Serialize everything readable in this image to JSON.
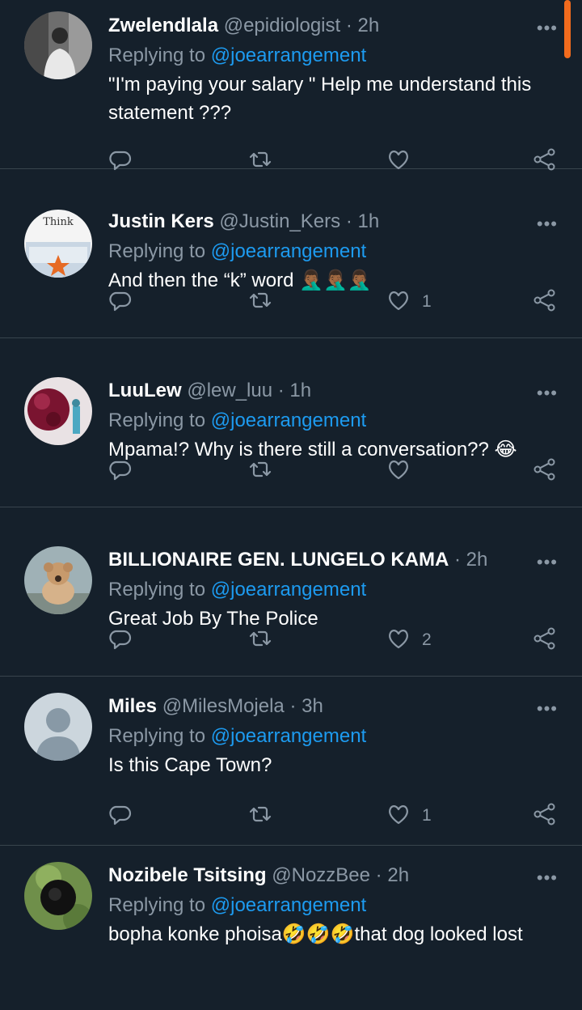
{
  "replying_prefix": "Replying to",
  "more_label": "•••",
  "colors": {
    "background": "#15202b",
    "muted": "#8b98a5",
    "link": "#1d9bf0",
    "divider": "#38444d",
    "scroll_indicator": "#f26b1d"
  },
  "icons": {
    "reply": "reply-icon",
    "retweet": "retweet-icon",
    "like": "heart-icon",
    "share": "share-icon",
    "more": "more-icon"
  },
  "tweets": [
    {
      "name": "Zwelendlala",
      "handle": "@epidiologist",
      "time": "2h",
      "replying_to": "@joearrangement",
      "text": "\"I'm paying your salary \" Help me understand this statement ???",
      "likes": ""
    },
    {
      "name": "Justin Kers",
      "handle": "@Justin_Kers",
      "time": "1h",
      "replying_to": "@joearrangement",
      "text": "And then the “k” word 🤦🏾‍♂️🤦🏾‍♂️🤦🏾‍♂️",
      "likes": "1"
    },
    {
      "name": "LuuLew",
      "handle": "@lew_luu",
      "time": "1h",
      "replying_to": "@joearrangement",
      "text": "Mpama!? Why is there still a conversation?? 😂",
      "likes": ""
    },
    {
      "name": "BILLIONAIRE GEN. LUNGELO KAMA",
      "handle": "",
      "time": "2h",
      "replying_to": "@joearrangement",
      "text": "Great Job By The Police",
      "likes": "2"
    },
    {
      "name": "Miles",
      "handle": "@MilesMojela",
      "time": "3h",
      "replying_to": "@joearrangement",
      "text": "Is this Cape Town?",
      "likes": "1"
    },
    {
      "name": "Nozibele Tsitsing",
      "handle": "@NozzBee",
      "time": "2h",
      "replying_to": "@joearrangement",
      "text": "bopha konke phoisa🤣🤣🤣that dog looked lost",
      "likes": ""
    }
  ],
  "avatar_caption": "Think"
}
